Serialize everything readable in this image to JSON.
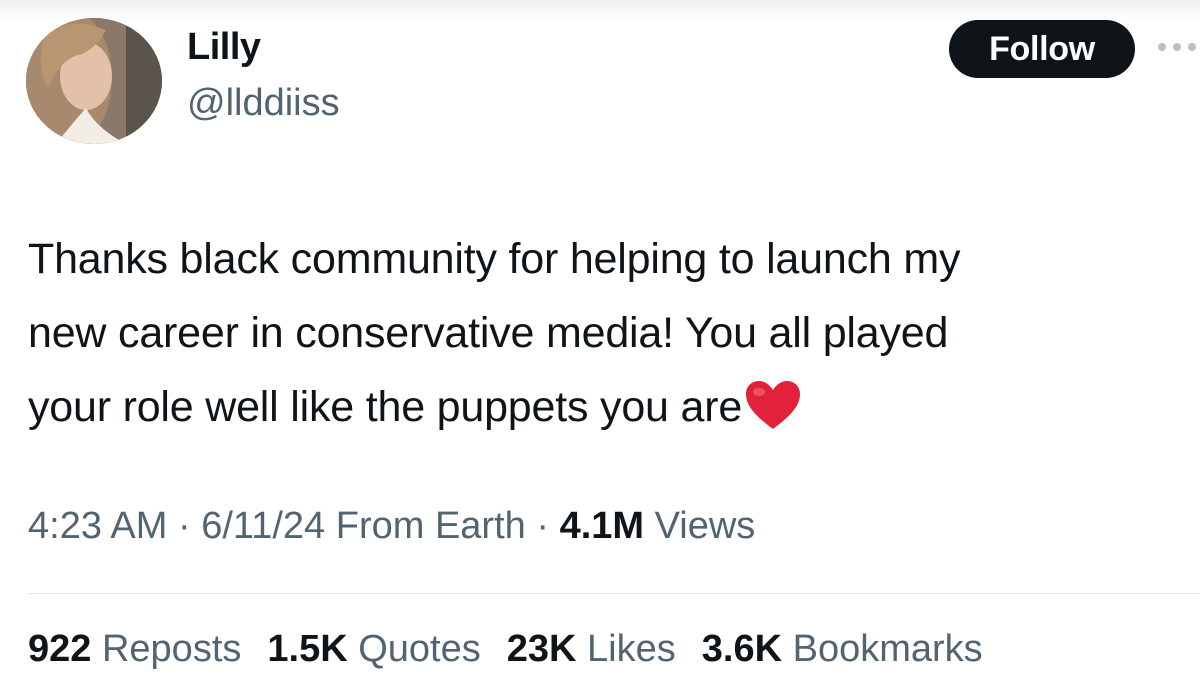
{
  "user": {
    "name": "Lilly",
    "handle": "@llddiiss"
  },
  "follow_label": "Follow",
  "tweet": {
    "lines": [
      "Thanks black community for helping to launch my",
      "new career in conservative media! You all played",
      "your role well like the puppets you are"
    ],
    "emoji": "red-heart"
  },
  "meta": {
    "time": "4:23 AM",
    "sep1": "·",
    "date": "6/11/24",
    "source": "From Earth",
    "sep2": "·",
    "views_count": "4.1M",
    "views_label": "Views"
  },
  "stats": [
    {
      "count": "922",
      "label": "Reposts"
    },
    {
      "count": "1.5K",
      "label": "Quotes"
    },
    {
      "count": "23K",
      "label": "Likes"
    },
    {
      "count": "3.6K",
      "label": "Bookmarks"
    }
  ],
  "colors": {
    "text": "#0f1419",
    "secondary": "#536471",
    "button_bg": "#0f1419",
    "heart": "#e2213a"
  }
}
